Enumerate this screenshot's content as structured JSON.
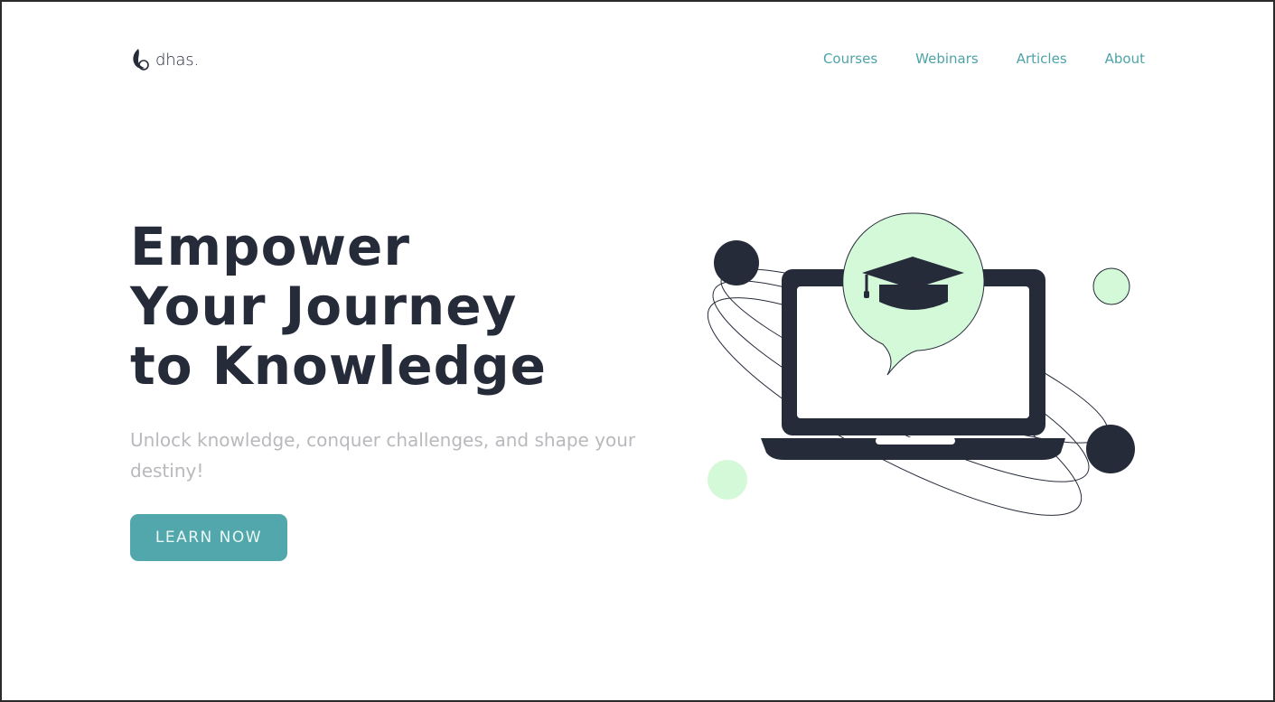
{
  "brand": {
    "name": "dhas.",
    "logo_icon": "crescent-drop-icon"
  },
  "nav": {
    "items": [
      {
        "label": "Courses"
      },
      {
        "label": "Webinars"
      },
      {
        "label": "Articles"
      },
      {
        "label": "About"
      }
    ]
  },
  "hero": {
    "title_lines": [
      "Empower",
      "Your Journey",
      "to Knowledge"
    ],
    "subtitle": "Unlock knowledge, conquer challenges, and shape your destiny!",
    "cta_label": "LEARN NOW"
  },
  "illustration": {
    "icons": [
      "laptop-icon",
      "speech-bubble-icon",
      "graduation-cap-icon"
    ],
    "colors": {
      "dark": "#262b3a",
      "mint": "#d4f9d8",
      "accent": "#52a7ac"
    }
  }
}
